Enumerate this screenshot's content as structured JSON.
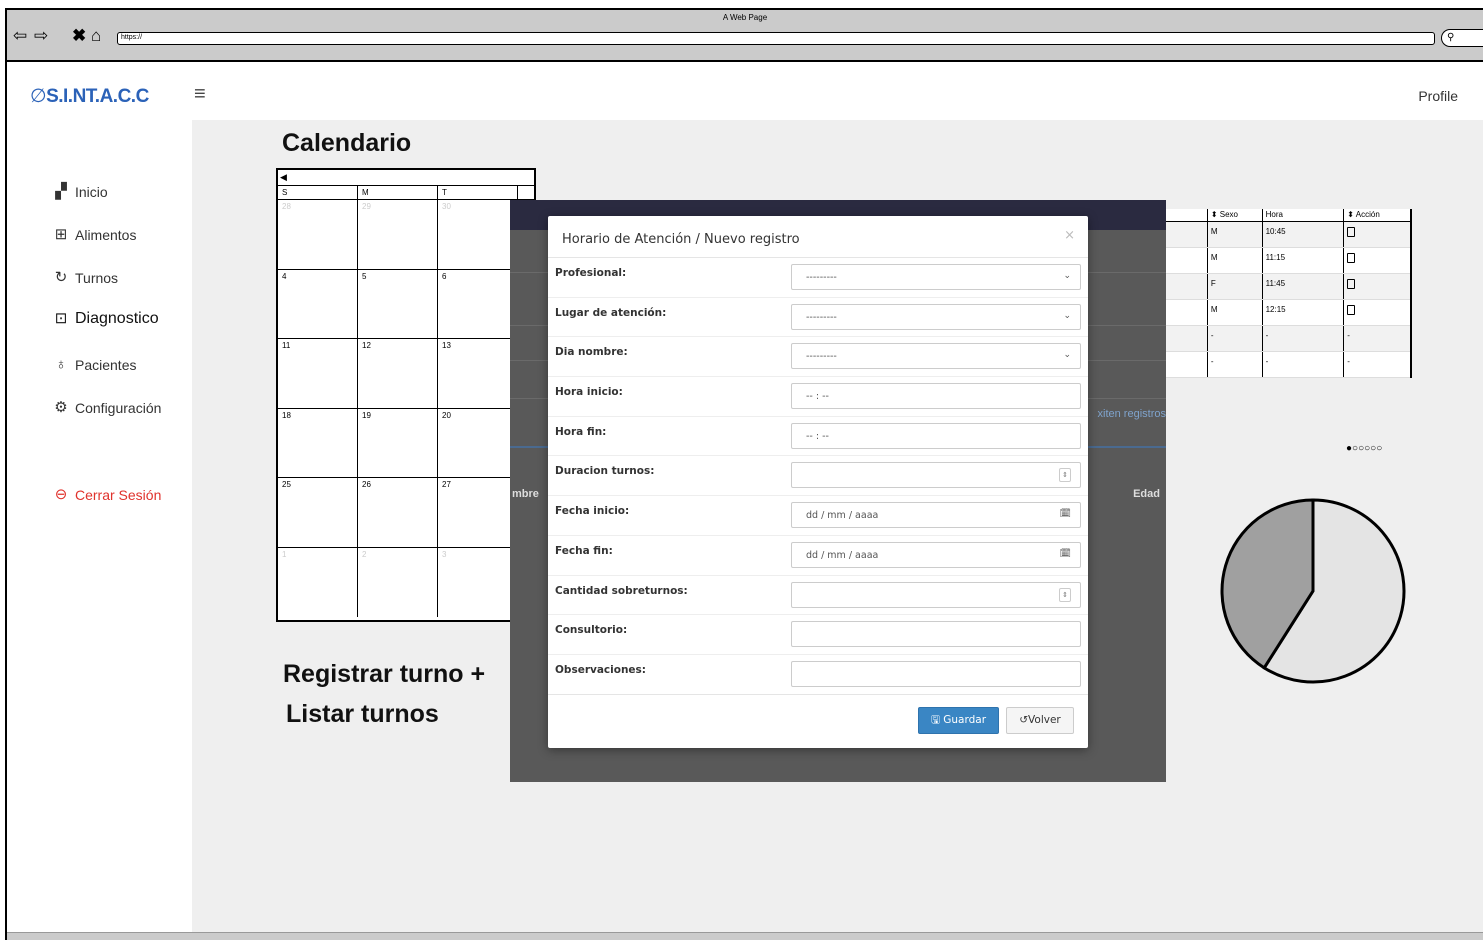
{
  "browser": {
    "title": "A Web Page",
    "url": "https://",
    "icons": [
      "back-arrow-icon",
      "forward-arrow-icon",
      "close-x-icon",
      "home-icon",
      "search-icon"
    ]
  },
  "app": {
    "brand": "S.I.NT.A.C.C",
    "brand_color": "#2b62b8",
    "profile": "Profile"
  },
  "sidebar": {
    "items": [
      {
        "label": "Inicio",
        "icon": "dashboard-icon"
      },
      {
        "label": "Alimentos",
        "icon": "grid-store-icon"
      },
      {
        "label": "Turnos",
        "icon": "cycle-icon"
      },
      {
        "label": "Diagnostico",
        "icon": "chat-dots-icon"
      },
      {
        "label": "Pacientes",
        "icon": "users-icon"
      },
      {
        "label": "Configuración",
        "icon": "gear-icon"
      }
    ],
    "logout": "Cerrar Sesión",
    "logout_color": "#e0322c"
  },
  "calendar": {
    "title": "Calendario",
    "nav_glyph": "◀",
    "days": [
      "S",
      "M",
      "T"
    ],
    "weeks": [
      [
        {
          "d": "28",
          "muted": true
        },
        {
          "d": "29",
          "muted": true
        },
        {
          "d": "30",
          "muted": true
        }
      ],
      [
        {
          "d": "4"
        },
        {
          "d": "5"
        },
        {
          "d": "6"
        }
      ],
      [
        {
          "d": "11"
        },
        {
          "d": "12"
        },
        {
          "d": "13"
        }
      ],
      [
        {
          "d": "18"
        },
        {
          "d": "19"
        },
        {
          "d": "20"
        }
      ],
      [
        {
          "d": "25"
        },
        {
          "d": "26"
        },
        {
          "d": "27"
        }
      ],
      [
        {
          "d": "1",
          "muted": true
        },
        {
          "d": "2",
          "muted": true
        },
        {
          "d": "3",
          "muted": true
        }
      ]
    ]
  },
  "actions": {
    "register": "Registrar turno +",
    "list": "Listar turnos"
  },
  "mini_table": {
    "headers": [
      "",
      "Sexo",
      "Hora",
      "Acción"
    ],
    "rows": [
      [
        "",
        "M",
        "10:45",
        true
      ],
      [
        "",
        "M",
        "11:15",
        true
      ],
      [
        "",
        "F",
        "11:45",
        true
      ],
      [
        "",
        "M",
        "12:15",
        true
      ],
      [
        "",
        "-",
        "-",
        "-"
      ],
      [
        "",
        "-",
        "-",
        "-"
      ]
    ],
    "pager": "●○○○○○"
  },
  "background_table": {
    "col_a": "mbre",
    "col_b": "Edad",
    "no_records": "xiten registros"
  },
  "pie": {
    "slices": [
      {
        "fraction": 0.59,
        "color": "#e4e4e4"
      },
      {
        "fraction": 0.41,
        "color": "#a0a0a0"
      }
    ]
  },
  "modal": {
    "title": "Horario de Atención / Nuevo registro",
    "close": "×",
    "fields": [
      {
        "label": "Profesional:",
        "value": "---------",
        "kind": "select"
      },
      {
        "label": "Lugar de atención:",
        "value": "---------",
        "kind": "select"
      },
      {
        "label": "Dia nombre:",
        "value": "---------",
        "kind": "select"
      },
      {
        "label": "Hora inicio:",
        "value": "-- : --",
        "kind": "time"
      },
      {
        "label": "Hora fin:",
        "value": "-- : --",
        "kind": "time"
      },
      {
        "label": "Duracion turnos:",
        "value": "",
        "kind": "number"
      },
      {
        "label": "Fecha inicio:",
        "value": "dd / mm / aaaa",
        "kind": "date"
      },
      {
        "label": "Fecha fin:",
        "value": "dd / mm / aaaa",
        "kind": "date"
      },
      {
        "label": "Cantidad sobreturnos:",
        "value": "",
        "kind": "number"
      },
      {
        "label": "Consultorio:",
        "value": "",
        "kind": "text"
      },
      {
        "label": "Observaciones:",
        "value": "",
        "kind": "text"
      }
    ],
    "save": "Guardar",
    "back": "Volver",
    "save_color": "#3a86c4"
  }
}
